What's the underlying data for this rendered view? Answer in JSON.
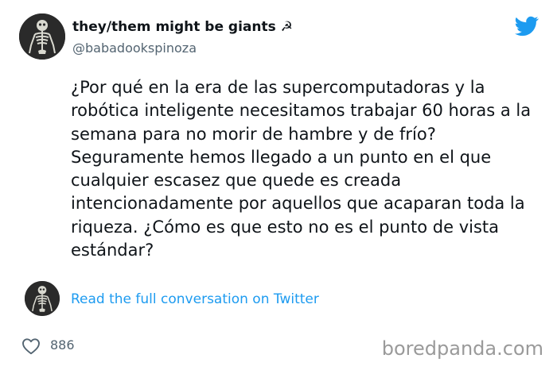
{
  "tweet": {
    "display_name": "they/them might be giants ☭",
    "handle": "@babadookspinoza",
    "text": "¿Por qué en la era de las supercomputadoras y la robótica inteligente necesitamos trabajar 60 horas a la semana para no morir de hambre y de frío? Seguramente hemos llegado a un punto en el que cualquier escasez que quede es creada intencionadamente por aquellos que acaparan toda la riqueza. ¿Cómo es que esto no es el punto de vista estándar?",
    "conversation_link": "Read the full conversation on Twitter",
    "like_count": "886"
  },
  "watermark": {
    "text": "boredpanda.com"
  },
  "colors": {
    "link": "#1d9bf0",
    "twitter_brand": "#1d9bf0",
    "muted": "#536471",
    "watermark": "#9a9a9a"
  },
  "icons": {
    "avatar": "skeleton-avatar-icon",
    "brand": "twitter-bird-icon",
    "like": "heart-outline-icon"
  }
}
